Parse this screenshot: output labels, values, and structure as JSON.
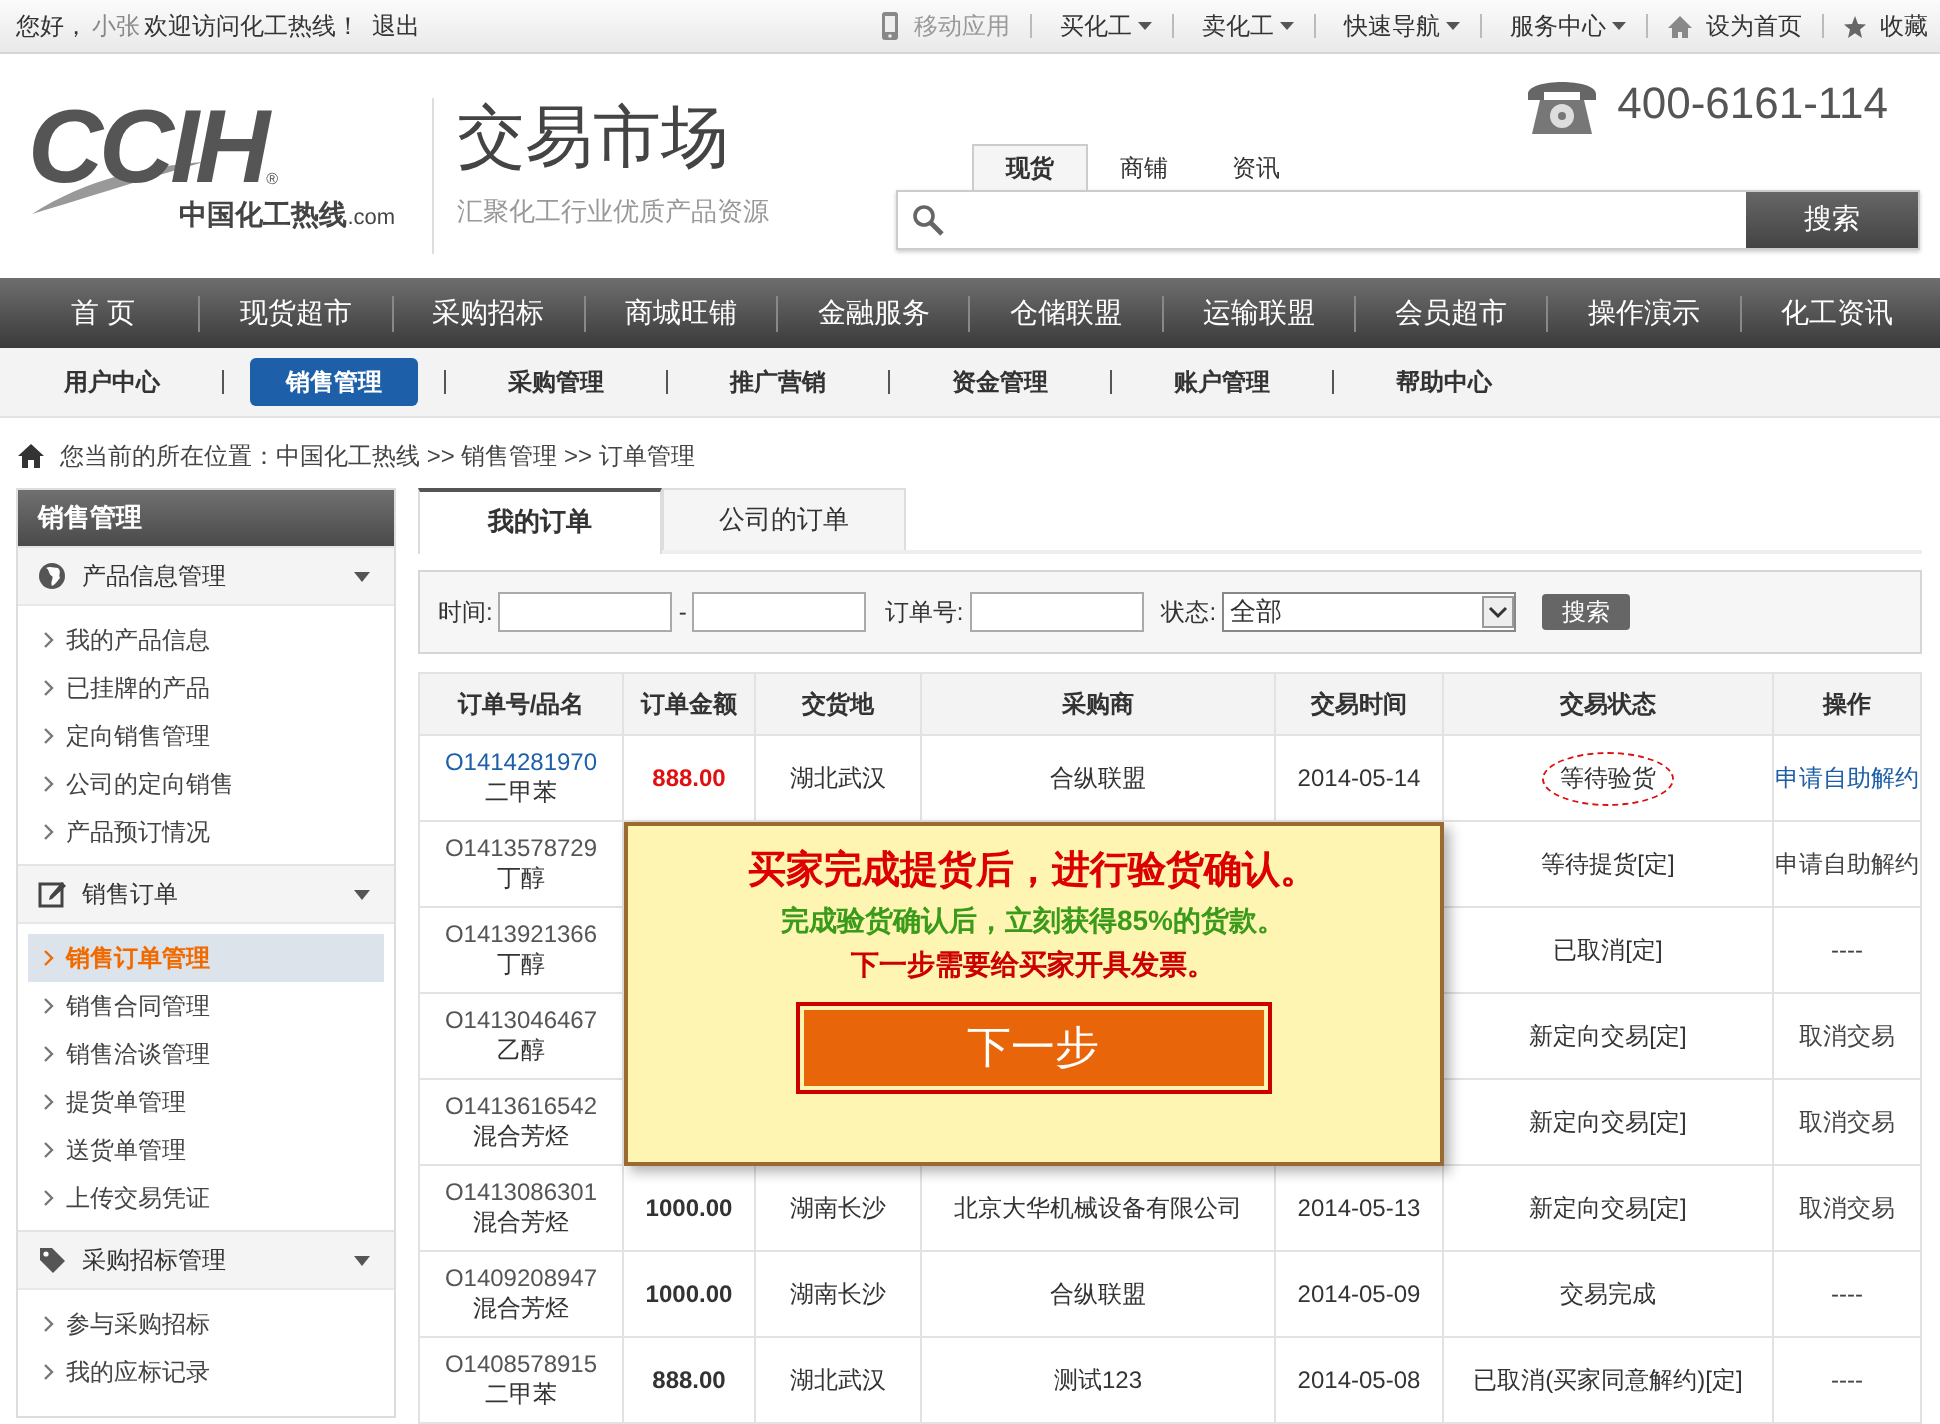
{
  "top_bar": {
    "greeting": "您好，",
    "user": "小张",
    "welcome": "欢迎访问化工热线！",
    "logout": "退出",
    "links": [
      {
        "kind": "phone",
        "label": "移动应用"
      },
      {
        "kind": "menu",
        "label": "买化工"
      },
      {
        "kind": "menu",
        "label": "卖化工"
      },
      {
        "kind": "menu",
        "label": "快速导航"
      },
      {
        "kind": "menu",
        "label": "服务中心"
      },
      {
        "kind": "home",
        "label": "设为首页"
      },
      {
        "kind": "star",
        "label": "收藏"
      }
    ]
  },
  "header": {
    "logo": {
      "mark": "CCIH",
      "reg": "®",
      "name": "中国化工热线",
      "domain": ".com"
    },
    "title": "交易市场",
    "subtitle": "汇聚化工行业优质产品资源",
    "search": {
      "tabs": [
        {
          "label": "现货",
          "selected": true
        },
        {
          "label": "商铺",
          "selected": false
        },
        {
          "label": "资讯",
          "selected": false
        }
      ],
      "button": "搜索"
    },
    "hotline": "400-6161-114"
  },
  "main_nav": [
    "首 页",
    "现货超市",
    "采购招标",
    "商城旺铺",
    "金融服务",
    "仓储联盟",
    "运输联盟",
    "会员超市",
    "操作演示",
    "化工资讯"
  ],
  "sub_nav": [
    {
      "label": "用户中心",
      "selected": false
    },
    {
      "label": "销售管理",
      "selected": true
    },
    {
      "label": "采购管理",
      "selected": false
    },
    {
      "label": "推广营销",
      "selected": false
    },
    {
      "label": "资金管理",
      "selected": false
    },
    {
      "label": "账户管理",
      "selected": false
    },
    {
      "label": "帮助中心",
      "selected": false
    }
  ],
  "breadcrumb": "您当前的所在位置：中国化工热线 >> 销售管理 >> 订单管理",
  "sidebar": {
    "title": "销售管理",
    "sections": [
      {
        "label": "产品信息管理",
        "expanded": true,
        "items": [
          {
            "label": "我的产品信息",
            "selected": false
          },
          {
            "label": "已挂牌的产品",
            "selected": false
          },
          {
            "label": "定向销售管理",
            "selected": false
          },
          {
            "label": "公司的定向销售",
            "selected": false
          },
          {
            "label": "产品预订情况",
            "selected": false
          }
        ]
      },
      {
        "label": "销售订单",
        "expanded": true,
        "items": [
          {
            "label": "销售订单管理",
            "selected": true
          },
          {
            "label": "销售合同管理",
            "selected": false
          },
          {
            "label": "销售洽谈管理",
            "selected": false
          },
          {
            "label": "提货单管理",
            "selected": false
          },
          {
            "label": "送货单管理",
            "selected": false
          },
          {
            "label": "上传交易凭证",
            "selected": false
          }
        ]
      },
      {
        "label": "采购招标管理",
        "expanded": true,
        "items": [
          {
            "label": "参与采购招标",
            "selected": false
          },
          {
            "label": "我的应标记录",
            "selected": false
          }
        ]
      }
    ]
  },
  "tabs": [
    {
      "label": "我的订单",
      "selected": true
    },
    {
      "label": "公司的订单",
      "selected": false
    }
  ],
  "filter": {
    "time_label": "时间:",
    "separator": "-",
    "order_label": "订单号:",
    "status_label": "状态:",
    "status_value": "全部",
    "button": "搜索"
  },
  "table": {
    "columns": [
      "订单号/品名",
      "订单金额",
      "交货地",
      "采购商",
      "交易时间",
      "交易状态",
      "操作"
    ],
    "rows": [
      {
        "order": "O1414281970",
        "product": "二甲苯",
        "amount": "888.00",
        "place": "湖北武汉",
        "buyer": "合纵联盟",
        "date": "2014-05-14",
        "status": "等待验货",
        "action": "申请自助解约",
        "current": true
      },
      {
        "order": "O1413578729",
        "product": "丁醇",
        "status": "等待提货[定]",
        "action": "申请自助解约",
        "current": false
      },
      {
        "order": "O1413921366",
        "product": "丁醇",
        "status": "已取消[定]",
        "action": "----",
        "current": false
      },
      {
        "order": "O1413046467",
        "product": "乙醇",
        "status": "新定向交易[定]",
        "action": "取消交易",
        "current": false
      },
      {
        "order": "O1413616542",
        "product": "混合芳烃",
        "status": "新定向交易[定]",
        "action": "取消交易",
        "current": false
      },
      {
        "order": "O1413086301",
        "product": "混合芳烃",
        "amount": "1000.00",
        "place": "湖南长沙",
        "buyer": "北京大华机械设备有限公司",
        "date": "2014-05-13",
        "status": "新定向交易[定]",
        "action": "取消交易",
        "current": false
      },
      {
        "order": "O1409208947",
        "product": "混合芳烃",
        "amount": "1000.00",
        "place": "湖南长沙",
        "buyer": "合纵联盟",
        "date": "2014-05-09",
        "status": "交易完成",
        "action": "----",
        "current": false
      },
      {
        "order": "O1408578915",
        "product": "二甲苯",
        "amount": "888.00",
        "place": "湖北武汉",
        "buyer": "测试123",
        "date": "2014-05-08",
        "status": "已取消(买家同意解约)[定]",
        "action": "----",
        "current": false
      }
    ]
  },
  "popup": {
    "headline": "买家完成提货后，进行验货确认。",
    "note": "完成验货确认后，立刻获得85%的货款。",
    "reminder": "下一步需要给买家开具发票。",
    "button": "下一步"
  }
}
